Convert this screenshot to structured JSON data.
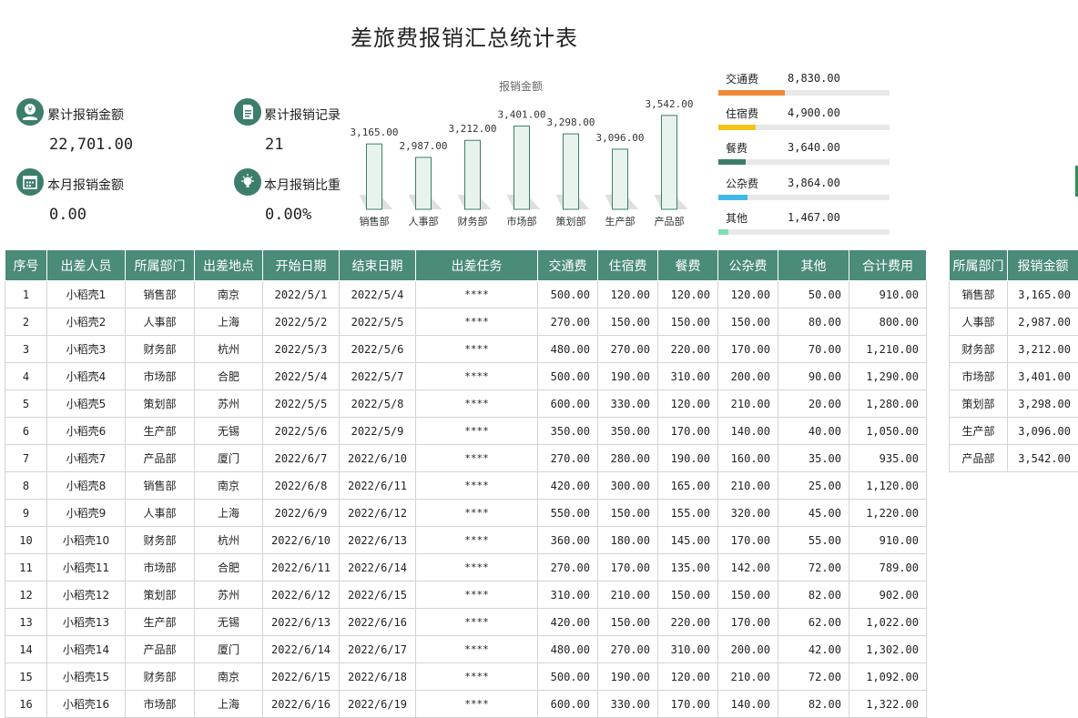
{
  "title": "差旅费报销汇总统计表",
  "kpis": {
    "total_amount_label": "累计报销金额",
    "total_amount_value": "22,701.00",
    "total_records_label": "累计报销记录",
    "total_records_value": "21",
    "month_amount_label": "本月报销金额",
    "month_amount_value": "0.00",
    "month_ratio_label": "本月报销比重",
    "month_ratio_value": "0.00%"
  },
  "chart_data": {
    "type": "bar",
    "title": "报销金额",
    "categories": [
      "销售部",
      "人事部",
      "财务部",
      "市场部",
      "策划部",
      "生产部",
      "产品部"
    ],
    "values": [
      3165.0,
      2987.0,
      3212.0,
      3401.0,
      3298.0,
      3096.0,
      3542.0
    ],
    "value_labels": [
      "3,165.00",
      "2,987.00",
      "3,212.00",
      "3,401.00",
      "3,298.00",
      "3,096.00",
      "3,542.00"
    ],
    "ylim": [
      2300,
      3600
    ],
    "grid": false,
    "legend": "none",
    "bar_color": "#e9f3ee",
    "bar_border": "#3d7d6d"
  },
  "expense_breakdown": [
    {
      "name": "交通费",
      "value": "8,830.00",
      "fraction": 0.39,
      "color": "#f08a36"
    },
    {
      "name": "住宿费",
      "value": "4,900.00",
      "fraction": 0.22,
      "color": "#f5c21a"
    },
    {
      "name": "餐费",
      "value": "3,640.00",
      "fraction": 0.16,
      "color": "#3d7d6d"
    },
    {
      "name": "公杂费",
      "value": "3,864.00",
      "fraction": 0.17,
      "color": "#3fb8ea"
    },
    {
      "name": "其他",
      "value": "1,467.00",
      "fraction": 0.06,
      "color": "#7fe0b0"
    }
  ],
  "main_table": {
    "headers": [
      "序号",
      "出差人员",
      "所属部门",
      "出差地点",
      "开始日期",
      "结束日期",
      "出差任务",
      "交通费",
      "住宿费",
      "餐费",
      "公杂费",
      "其他",
      "合计费用"
    ],
    "rows": [
      [
        "1",
        "小稻壳1",
        "销售部",
        "南京",
        "2022/5/1",
        "2022/5/4",
        "****",
        "500.00",
        "120.00",
        "120.00",
        "120.00",
        "50.00",
        "910.00"
      ],
      [
        "2",
        "小稻壳2",
        "人事部",
        "上海",
        "2022/5/2",
        "2022/5/5",
        "****",
        "270.00",
        "150.00",
        "150.00",
        "150.00",
        "80.00",
        "800.00"
      ],
      [
        "3",
        "小稻壳3",
        "财务部",
        "杭州",
        "2022/5/3",
        "2022/5/6",
        "****",
        "480.00",
        "270.00",
        "220.00",
        "170.00",
        "70.00",
        "1,210.00"
      ],
      [
        "4",
        "小稻壳4",
        "市场部",
        "合肥",
        "2022/5/4",
        "2022/5/7",
        "****",
        "500.00",
        "190.00",
        "310.00",
        "200.00",
        "90.00",
        "1,290.00"
      ],
      [
        "5",
        "小稻壳5",
        "策划部",
        "苏州",
        "2022/5/5",
        "2022/5/8",
        "****",
        "600.00",
        "330.00",
        "120.00",
        "210.00",
        "20.00",
        "1,280.00"
      ],
      [
        "6",
        "小稻壳6",
        "生产部",
        "无锡",
        "2022/5/6",
        "2022/5/9",
        "****",
        "350.00",
        "350.00",
        "170.00",
        "140.00",
        "40.00",
        "1,050.00"
      ],
      [
        "7",
        "小稻壳7",
        "产品部",
        "厦门",
        "2022/6/7",
        "2022/6/10",
        "****",
        "270.00",
        "280.00",
        "190.00",
        "160.00",
        "35.00",
        "935.00"
      ],
      [
        "8",
        "小稻壳8",
        "销售部",
        "南京",
        "2022/6/8",
        "2022/6/11",
        "****",
        "420.00",
        "300.00",
        "165.00",
        "210.00",
        "25.00",
        "1,120.00"
      ],
      [
        "9",
        "小稻壳9",
        "人事部",
        "上海",
        "2022/6/9",
        "2022/6/12",
        "****",
        "550.00",
        "150.00",
        "155.00",
        "320.00",
        "45.00",
        "1,220.00"
      ],
      [
        "10",
        "小稻壳10",
        "财务部",
        "杭州",
        "2022/6/10",
        "2022/6/13",
        "****",
        "360.00",
        "180.00",
        "145.00",
        "170.00",
        "55.00",
        "910.00"
      ],
      [
        "11",
        "小稻壳11",
        "市场部",
        "合肥",
        "2022/6/11",
        "2022/6/14",
        "****",
        "270.00",
        "170.00",
        "135.00",
        "142.00",
        "72.00",
        "789.00"
      ],
      [
        "12",
        "小稻壳12",
        "策划部",
        "苏州",
        "2022/6/12",
        "2022/6/15",
        "****",
        "310.00",
        "210.00",
        "150.00",
        "150.00",
        "82.00",
        "902.00"
      ],
      [
        "13",
        "小稻壳13",
        "生产部",
        "无锡",
        "2022/6/13",
        "2022/6/16",
        "****",
        "420.00",
        "150.00",
        "220.00",
        "170.00",
        "62.00",
        "1,022.00"
      ],
      [
        "14",
        "小稻壳14",
        "产品部",
        "厦门",
        "2022/6/14",
        "2022/6/17",
        "****",
        "480.00",
        "270.00",
        "310.00",
        "200.00",
        "42.00",
        "1,302.00"
      ],
      [
        "15",
        "小稻壳15",
        "财务部",
        "南京",
        "2022/6/15",
        "2022/6/18",
        "****",
        "500.00",
        "190.00",
        "120.00",
        "210.00",
        "72.00",
        "1,092.00"
      ],
      [
        "16",
        "小稻壳16",
        "市场部",
        "上海",
        "2022/6/16",
        "2022/6/19",
        "****",
        "600.00",
        "330.00",
        "170.00",
        "140.00",
        "82.00",
        "1,322.00"
      ]
    ]
  },
  "dept_table": {
    "headers": [
      "所属部门",
      "报销金额"
    ],
    "rows": [
      [
        "销售部",
        "3,165.00"
      ],
      [
        "人事部",
        "2,987.00"
      ],
      [
        "财务部",
        "3,212.00"
      ],
      [
        "市场部",
        "3,401.00"
      ],
      [
        "策划部",
        "3,298.00"
      ],
      [
        "生产部",
        "3,096.00"
      ],
      [
        "产品部",
        "3,542.00"
      ]
    ]
  }
}
